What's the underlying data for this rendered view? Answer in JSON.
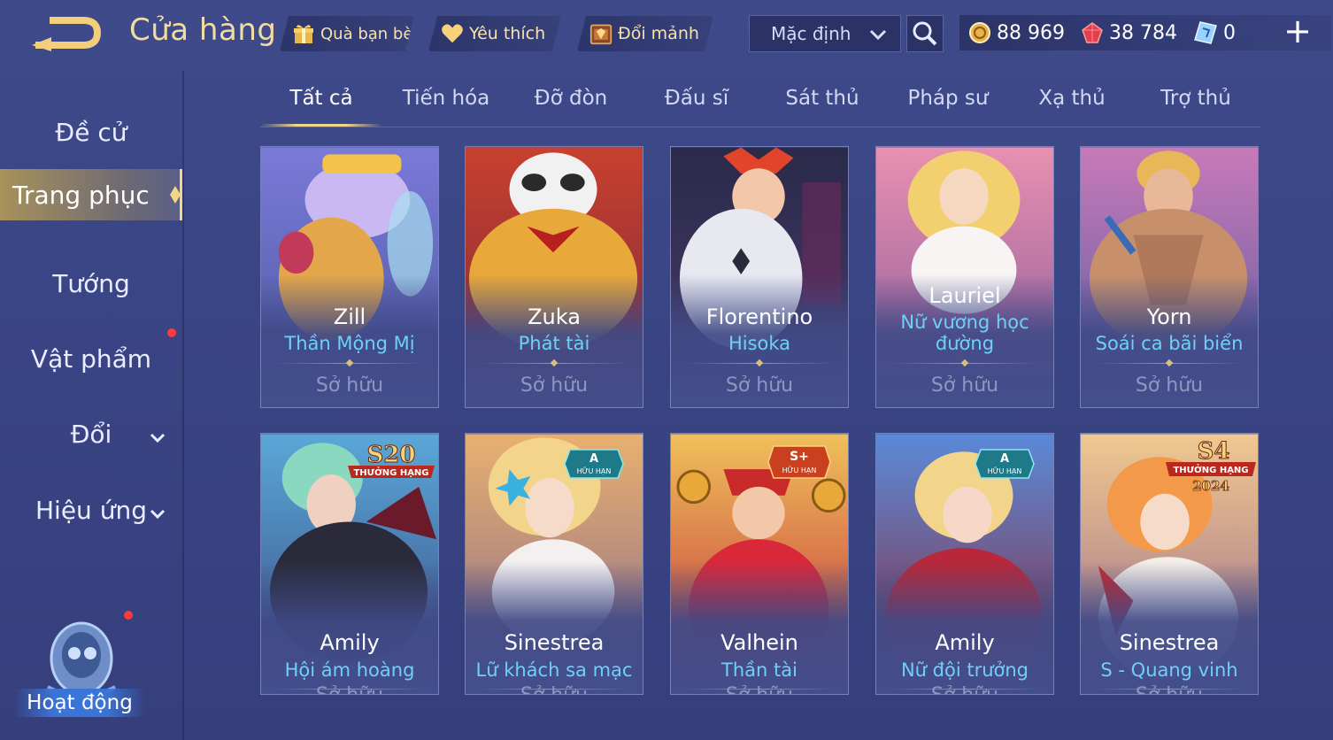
{
  "header": {
    "title": "Cửa hàng",
    "friend_gift": "Quà bạn bè",
    "favorites": "Yêu thích",
    "exchange_shards": "Đổi mảnh",
    "sort": "Mặc định",
    "currencies": [
      {
        "icon": "gold-coin-icon",
        "value": "88 969"
      },
      {
        "icon": "ruby-icon",
        "value": "38 784"
      },
      {
        "icon": "voucher-icon",
        "value": "0"
      }
    ],
    "plus": "+"
  },
  "sidebar": {
    "items": [
      {
        "label": "Đề cử"
      },
      {
        "label": "Trang phục"
      },
      {
        "label": "Tướng"
      },
      {
        "label": "Vật phẩm"
      },
      {
        "label": "Đổi"
      },
      {
        "label": "Hiệu ứng"
      }
    ],
    "activity": "Hoạt động"
  },
  "tabs": [
    "Tất cả",
    "Tiến hóa",
    "Đỡ đòn",
    "Đấu sĩ",
    "Sát thủ",
    "Pháp sư",
    "Xạ thủ",
    "Trợ thủ"
  ],
  "owned_label": "Sở hữu",
  "cards": [
    {
      "hero": "Zill",
      "skin": "Thần Mộng Mị"
    },
    {
      "hero": "Zuka",
      "skin": "Phát tài"
    },
    {
      "hero": "Florentino",
      "skin": "Hisoka"
    },
    {
      "hero": "Lauriel",
      "skin_line1": "Nữ vương học",
      "skin_line2": "đường"
    },
    {
      "hero": "Yorn",
      "skin": "Soái ca bãi biển"
    },
    {
      "hero": "Amily",
      "skin": "Hội ám hoàng",
      "badge_title": "S20",
      "badge_sub": "THƯỞNG HẠNG"
    },
    {
      "hero": "Sinestrea",
      "skin": "Lữ khách sa mạc",
      "badge_title": "A",
      "badge_sub": "HỮU HẠN"
    },
    {
      "hero": "Valhein",
      "skin": "Thần tài",
      "badge_title": "S+",
      "badge_sub": "HỮU HẠN"
    },
    {
      "hero": "Amily",
      "skin": "Nữ đội trưởng",
      "badge_title": "A",
      "badge_sub": "HỮU HẠN"
    },
    {
      "hero": "Sinestrea",
      "skin": "S - Quang vinh",
      "badge_title": "S4",
      "badge_sub": "THƯỞNG HẠNG",
      "badge_year": "2024"
    }
  ],
  "colors": {
    "background": "#3a4585",
    "gold": "#f1dca6",
    "skin_text": "#6fd0f7",
    "owned_text": "#8f97c0",
    "red_dot": "#ff3a3a"
  }
}
